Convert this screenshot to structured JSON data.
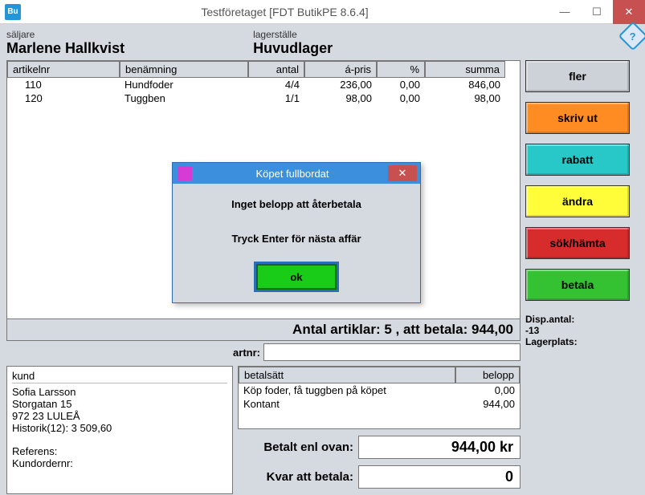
{
  "window": {
    "app_icon_text": "Bu",
    "title": "Testföretaget [FDT ButikPE 8.6.4]"
  },
  "header": {
    "seller_label": "säljare",
    "seller_name": "Marlene Hallkvist",
    "warehouse_label": "lagerställe",
    "warehouse_name": "Huvudlager",
    "help": "?"
  },
  "table": {
    "cols": {
      "artnr": "artikelnr",
      "ben": "benämning",
      "antal": "antal",
      "pris": "á-pris",
      "proc": "%",
      "summa": "summa"
    },
    "rows": [
      {
        "artnr": "110",
        "ben": "Hundfoder",
        "antal": "4/4",
        "pris": "236,00",
        "proc": "0,00",
        "summa": "846,00"
      },
      {
        "artnr": "120",
        "ben": "Tuggben",
        "antal": "1/1",
        "pris": "98,00",
        "proc": "0,00",
        "summa": "98,00"
      }
    ]
  },
  "totals": "Antal artiklar: 5 , att betala: 944,00",
  "artnr_label": "artnr:",
  "artnr_value": "",
  "kund": {
    "head": "kund",
    "name": "Sofia Larsson",
    "addr1": "Storgatan 15",
    "addr2": "972 23 LULEÅ",
    "hist": "Historik(12): 3 509,60",
    "ref": "Referens:",
    "kord": "Kundordernr:"
  },
  "pay": {
    "cols": {
      "name": "betalsätt",
      "amount": "belopp"
    },
    "rows": [
      {
        "name": "Köp foder, få tuggben på köpet",
        "amount": "0,00"
      },
      {
        "name": "Kontant",
        "amount": "944,00"
      }
    ],
    "paid_label": "Betalt enl ovan:",
    "paid_value": "944,00 kr",
    "remain_label": "Kvar att betala:",
    "remain_value": "0"
  },
  "buttons": {
    "more": "fler",
    "print": "skriv ut",
    "discount": "rabatt",
    "change": "ändra",
    "search": "sök/hämta",
    "pay": "betala"
  },
  "disp": {
    "l1": "Disp.antal:",
    "l2": "-13",
    "l3": "Lagerplats:"
  },
  "dialog": {
    "title": "Köpet fullbordat",
    "line1": "Inget belopp att återbetala",
    "line2": "Tryck Enter för nästa affär",
    "ok": "ok"
  },
  "winbtns": {
    "min": "—",
    "max": "☐",
    "close": "✕"
  }
}
